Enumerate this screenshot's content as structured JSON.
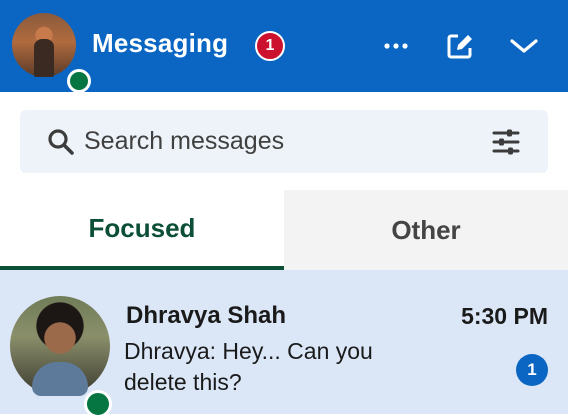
{
  "header": {
    "title": "Messaging",
    "notification_count": "1",
    "icons": [
      "more-icon",
      "compose-icon",
      "chevron-down-icon"
    ]
  },
  "search": {
    "placeholder": "Search messages"
  },
  "tabs": [
    {
      "label": "Focused",
      "active": true
    },
    {
      "label": "Other",
      "active": false
    }
  ],
  "conversations": [
    {
      "sender": "Dhravya Shah",
      "time": "5:30 PM",
      "preview": "Dhravya: Hey... Can you delete this?",
      "unread_count": "1",
      "online": true
    }
  ],
  "colors": {
    "brand": "#0a66c2",
    "badge": "#cb112d",
    "online": "#057642",
    "focused_tab": "#0b4f36",
    "selected_row": "#dbe7f7"
  }
}
